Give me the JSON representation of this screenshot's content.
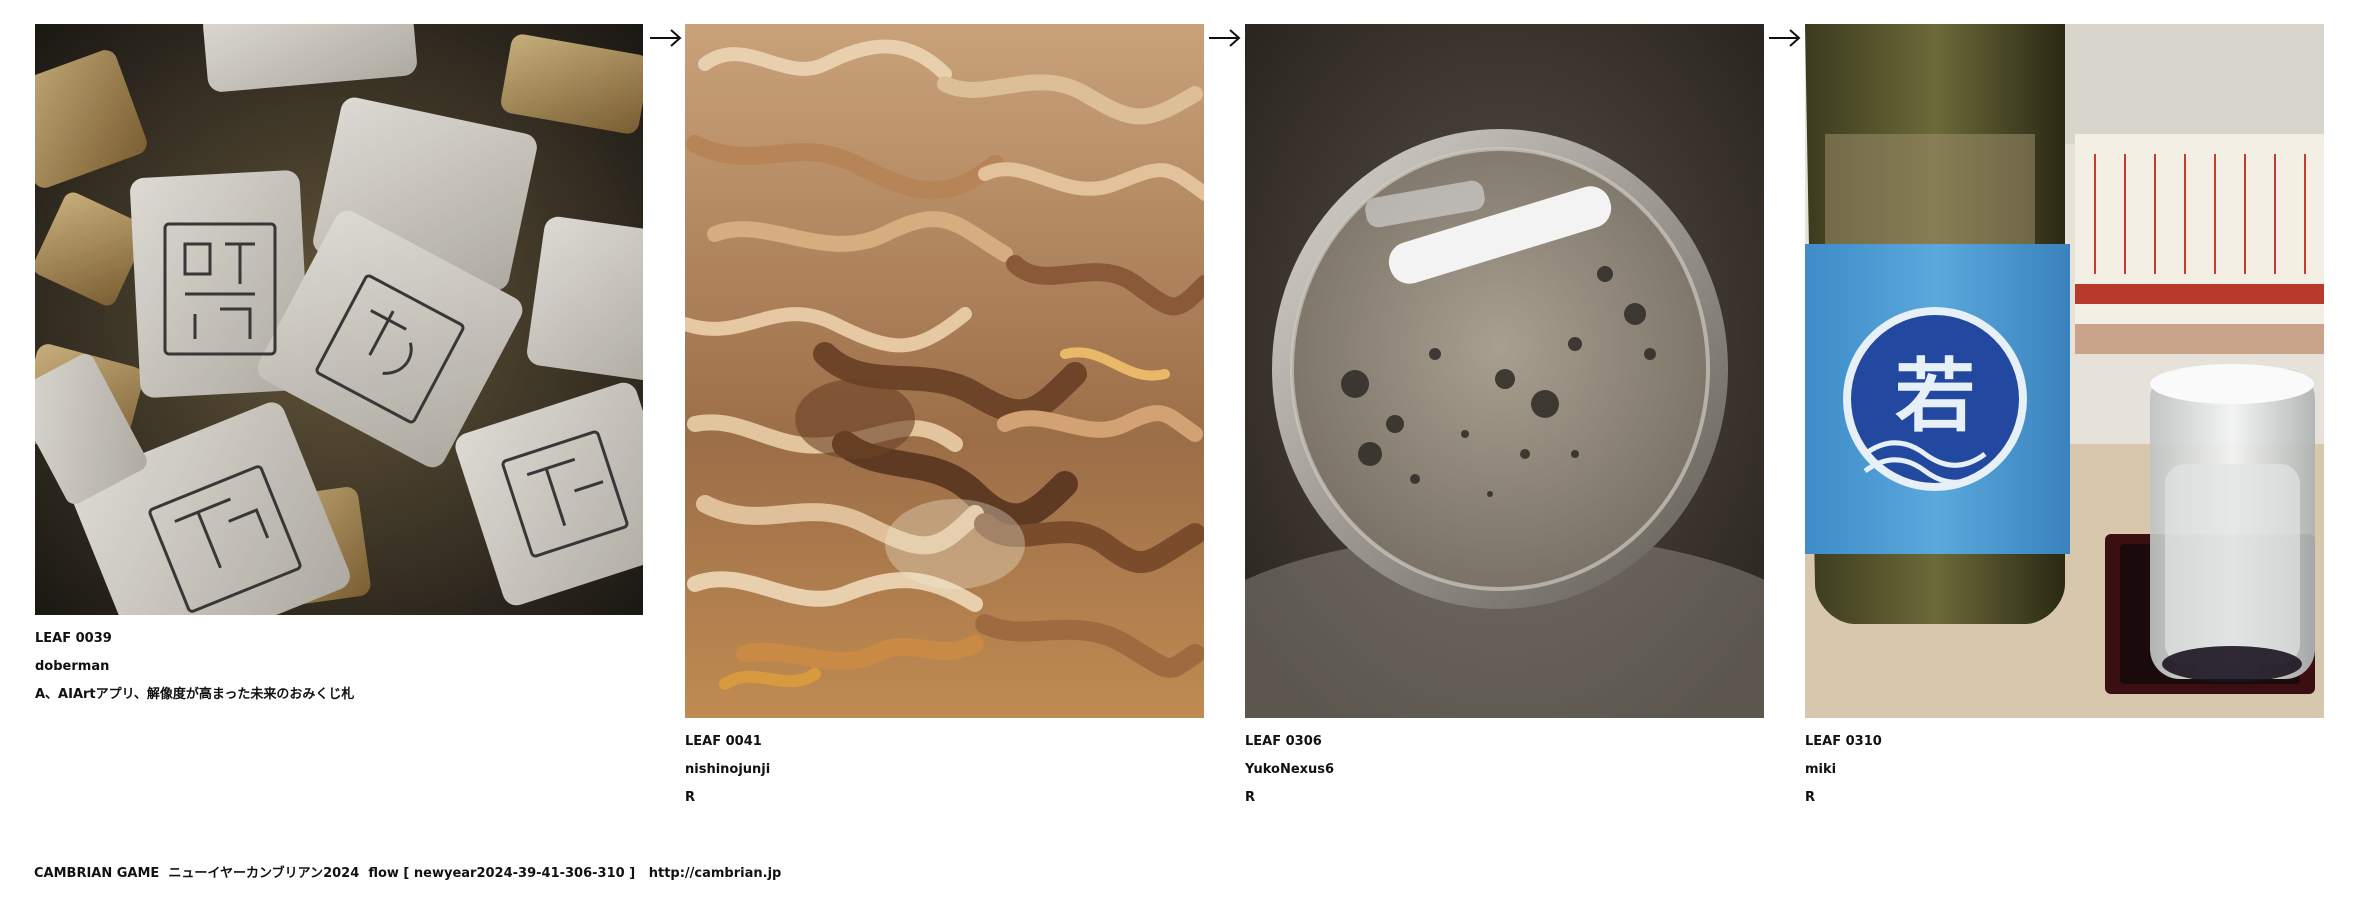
{
  "leaves": [
    {
      "id": "LEAF 0039",
      "author": "doberman",
      "text": "A、AIArtアプリ、解像度が高まった未来のおみくじ札"
    },
    {
      "id": "LEAF 0041",
      "author": "nishinojunji",
      "text": "R"
    },
    {
      "id": "LEAF 0306",
      "author": "YukoNexus6",
      "text": "R"
    },
    {
      "id": "LEAF 0310",
      "author": "miki",
      "text": "R"
    }
  ],
  "footer": {
    "game": "CAMBRIAN GAME",
    "title": "ニューイヤーカンブリアン2024",
    "flow": "flow [ newyear2024-39-41-306-310 ]",
    "url": "http://cambrian.jp"
  },
  "icons": {
    "arrow": "right-arrow-icon",
    "label_1": "若"
  },
  "colors": {
    "label_blue": "#4a9bd3",
    "seal_blue": "#1f4fa6"
  }
}
